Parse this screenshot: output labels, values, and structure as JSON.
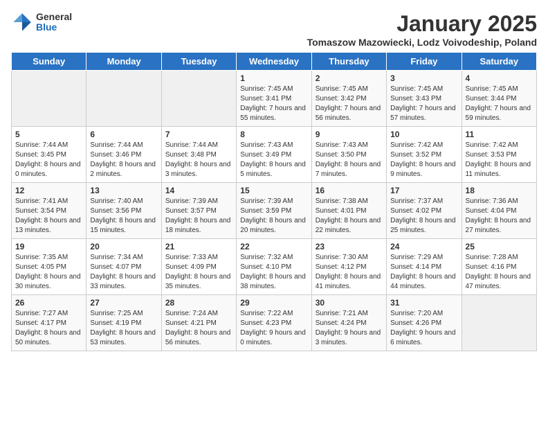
{
  "header": {
    "logo_general": "General",
    "logo_blue": "Blue",
    "month_title": "January 2025",
    "subtitle": "Tomaszow Mazowiecki, Lodz Voivodeship, Poland"
  },
  "weekdays": [
    "Sunday",
    "Monday",
    "Tuesday",
    "Wednesday",
    "Thursday",
    "Friday",
    "Saturday"
  ],
  "weeks": [
    [
      {
        "day": "",
        "sunrise": "",
        "sunset": "",
        "daylight": "",
        "empty": true
      },
      {
        "day": "",
        "sunrise": "",
        "sunset": "",
        "daylight": "",
        "empty": true
      },
      {
        "day": "",
        "sunrise": "",
        "sunset": "",
        "daylight": "",
        "empty": true
      },
      {
        "day": "1",
        "sunrise": "Sunrise: 7:45 AM",
        "sunset": "Sunset: 3:41 PM",
        "daylight": "Daylight: 7 hours and 55 minutes."
      },
      {
        "day": "2",
        "sunrise": "Sunrise: 7:45 AM",
        "sunset": "Sunset: 3:42 PM",
        "daylight": "Daylight: 7 hours and 56 minutes."
      },
      {
        "day": "3",
        "sunrise": "Sunrise: 7:45 AM",
        "sunset": "Sunset: 3:43 PM",
        "daylight": "Daylight: 7 hours and 57 minutes."
      },
      {
        "day": "4",
        "sunrise": "Sunrise: 7:45 AM",
        "sunset": "Sunset: 3:44 PM",
        "daylight": "Daylight: 7 hours and 59 minutes."
      }
    ],
    [
      {
        "day": "5",
        "sunrise": "Sunrise: 7:44 AM",
        "sunset": "Sunset: 3:45 PM",
        "daylight": "Daylight: 8 hours and 0 minutes."
      },
      {
        "day": "6",
        "sunrise": "Sunrise: 7:44 AM",
        "sunset": "Sunset: 3:46 PM",
        "daylight": "Daylight: 8 hours and 2 minutes."
      },
      {
        "day": "7",
        "sunrise": "Sunrise: 7:44 AM",
        "sunset": "Sunset: 3:48 PM",
        "daylight": "Daylight: 8 hours and 3 minutes."
      },
      {
        "day": "8",
        "sunrise": "Sunrise: 7:43 AM",
        "sunset": "Sunset: 3:49 PM",
        "daylight": "Daylight: 8 hours and 5 minutes."
      },
      {
        "day": "9",
        "sunrise": "Sunrise: 7:43 AM",
        "sunset": "Sunset: 3:50 PM",
        "daylight": "Daylight: 8 hours and 7 minutes."
      },
      {
        "day": "10",
        "sunrise": "Sunrise: 7:42 AM",
        "sunset": "Sunset: 3:52 PM",
        "daylight": "Daylight: 8 hours and 9 minutes."
      },
      {
        "day": "11",
        "sunrise": "Sunrise: 7:42 AM",
        "sunset": "Sunset: 3:53 PM",
        "daylight": "Daylight: 8 hours and 11 minutes."
      }
    ],
    [
      {
        "day": "12",
        "sunrise": "Sunrise: 7:41 AM",
        "sunset": "Sunset: 3:54 PM",
        "daylight": "Daylight: 8 hours and 13 minutes."
      },
      {
        "day": "13",
        "sunrise": "Sunrise: 7:40 AM",
        "sunset": "Sunset: 3:56 PM",
        "daylight": "Daylight: 8 hours and 15 minutes."
      },
      {
        "day": "14",
        "sunrise": "Sunrise: 7:39 AM",
        "sunset": "Sunset: 3:57 PM",
        "daylight": "Daylight: 8 hours and 18 minutes."
      },
      {
        "day": "15",
        "sunrise": "Sunrise: 7:39 AM",
        "sunset": "Sunset: 3:59 PM",
        "daylight": "Daylight: 8 hours and 20 minutes."
      },
      {
        "day": "16",
        "sunrise": "Sunrise: 7:38 AM",
        "sunset": "Sunset: 4:01 PM",
        "daylight": "Daylight: 8 hours and 22 minutes."
      },
      {
        "day": "17",
        "sunrise": "Sunrise: 7:37 AM",
        "sunset": "Sunset: 4:02 PM",
        "daylight": "Daylight: 8 hours and 25 minutes."
      },
      {
        "day": "18",
        "sunrise": "Sunrise: 7:36 AM",
        "sunset": "Sunset: 4:04 PM",
        "daylight": "Daylight: 8 hours and 27 minutes."
      }
    ],
    [
      {
        "day": "19",
        "sunrise": "Sunrise: 7:35 AM",
        "sunset": "Sunset: 4:05 PM",
        "daylight": "Daylight: 8 hours and 30 minutes."
      },
      {
        "day": "20",
        "sunrise": "Sunrise: 7:34 AM",
        "sunset": "Sunset: 4:07 PM",
        "daylight": "Daylight: 8 hours and 33 minutes."
      },
      {
        "day": "21",
        "sunrise": "Sunrise: 7:33 AM",
        "sunset": "Sunset: 4:09 PM",
        "daylight": "Daylight: 8 hours and 35 minutes."
      },
      {
        "day": "22",
        "sunrise": "Sunrise: 7:32 AM",
        "sunset": "Sunset: 4:10 PM",
        "daylight": "Daylight: 8 hours and 38 minutes."
      },
      {
        "day": "23",
        "sunrise": "Sunrise: 7:30 AM",
        "sunset": "Sunset: 4:12 PM",
        "daylight": "Daylight: 8 hours and 41 minutes."
      },
      {
        "day": "24",
        "sunrise": "Sunrise: 7:29 AM",
        "sunset": "Sunset: 4:14 PM",
        "daylight": "Daylight: 8 hours and 44 minutes."
      },
      {
        "day": "25",
        "sunrise": "Sunrise: 7:28 AM",
        "sunset": "Sunset: 4:16 PM",
        "daylight": "Daylight: 8 hours and 47 minutes."
      }
    ],
    [
      {
        "day": "26",
        "sunrise": "Sunrise: 7:27 AM",
        "sunset": "Sunset: 4:17 PM",
        "daylight": "Daylight: 8 hours and 50 minutes."
      },
      {
        "day": "27",
        "sunrise": "Sunrise: 7:25 AM",
        "sunset": "Sunset: 4:19 PM",
        "daylight": "Daylight: 8 hours and 53 minutes."
      },
      {
        "day": "28",
        "sunrise": "Sunrise: 7:24 AM",
        "sunset": "Sunset: 4:21 PM",
        "daylight": "Daylight: 8 hours and 56 minutes."
      },
      {
        "day": "29",
        "sunrise": "Sunrise: 7:22 AM",
        "sunset": "Sunset: 4:23 PM",
        "daylight": "Daylight: 9 hours and 0 minutes."
      },
      {
        "day": "30",
        "sunrise": "Sunrise: 7:21 AM",
        "sunset": "Sunset: 4:24 PM",
        "daylight": "Daylight: 9 hours and 3 minutes."
      },
      {
        "day": "31",
        "sunrise": "Sunrise: 7:20 AM",
        "sunset": "Sunset: 4:26 PM",
        "daylight": "Daylight: 9 hours and 6 minutes."
      },
      {
        "day": "",
        "sunrise": "",
        "sunset": "",
        "daylight": "",
        "empty": true
      }
    ]
  ]
}
